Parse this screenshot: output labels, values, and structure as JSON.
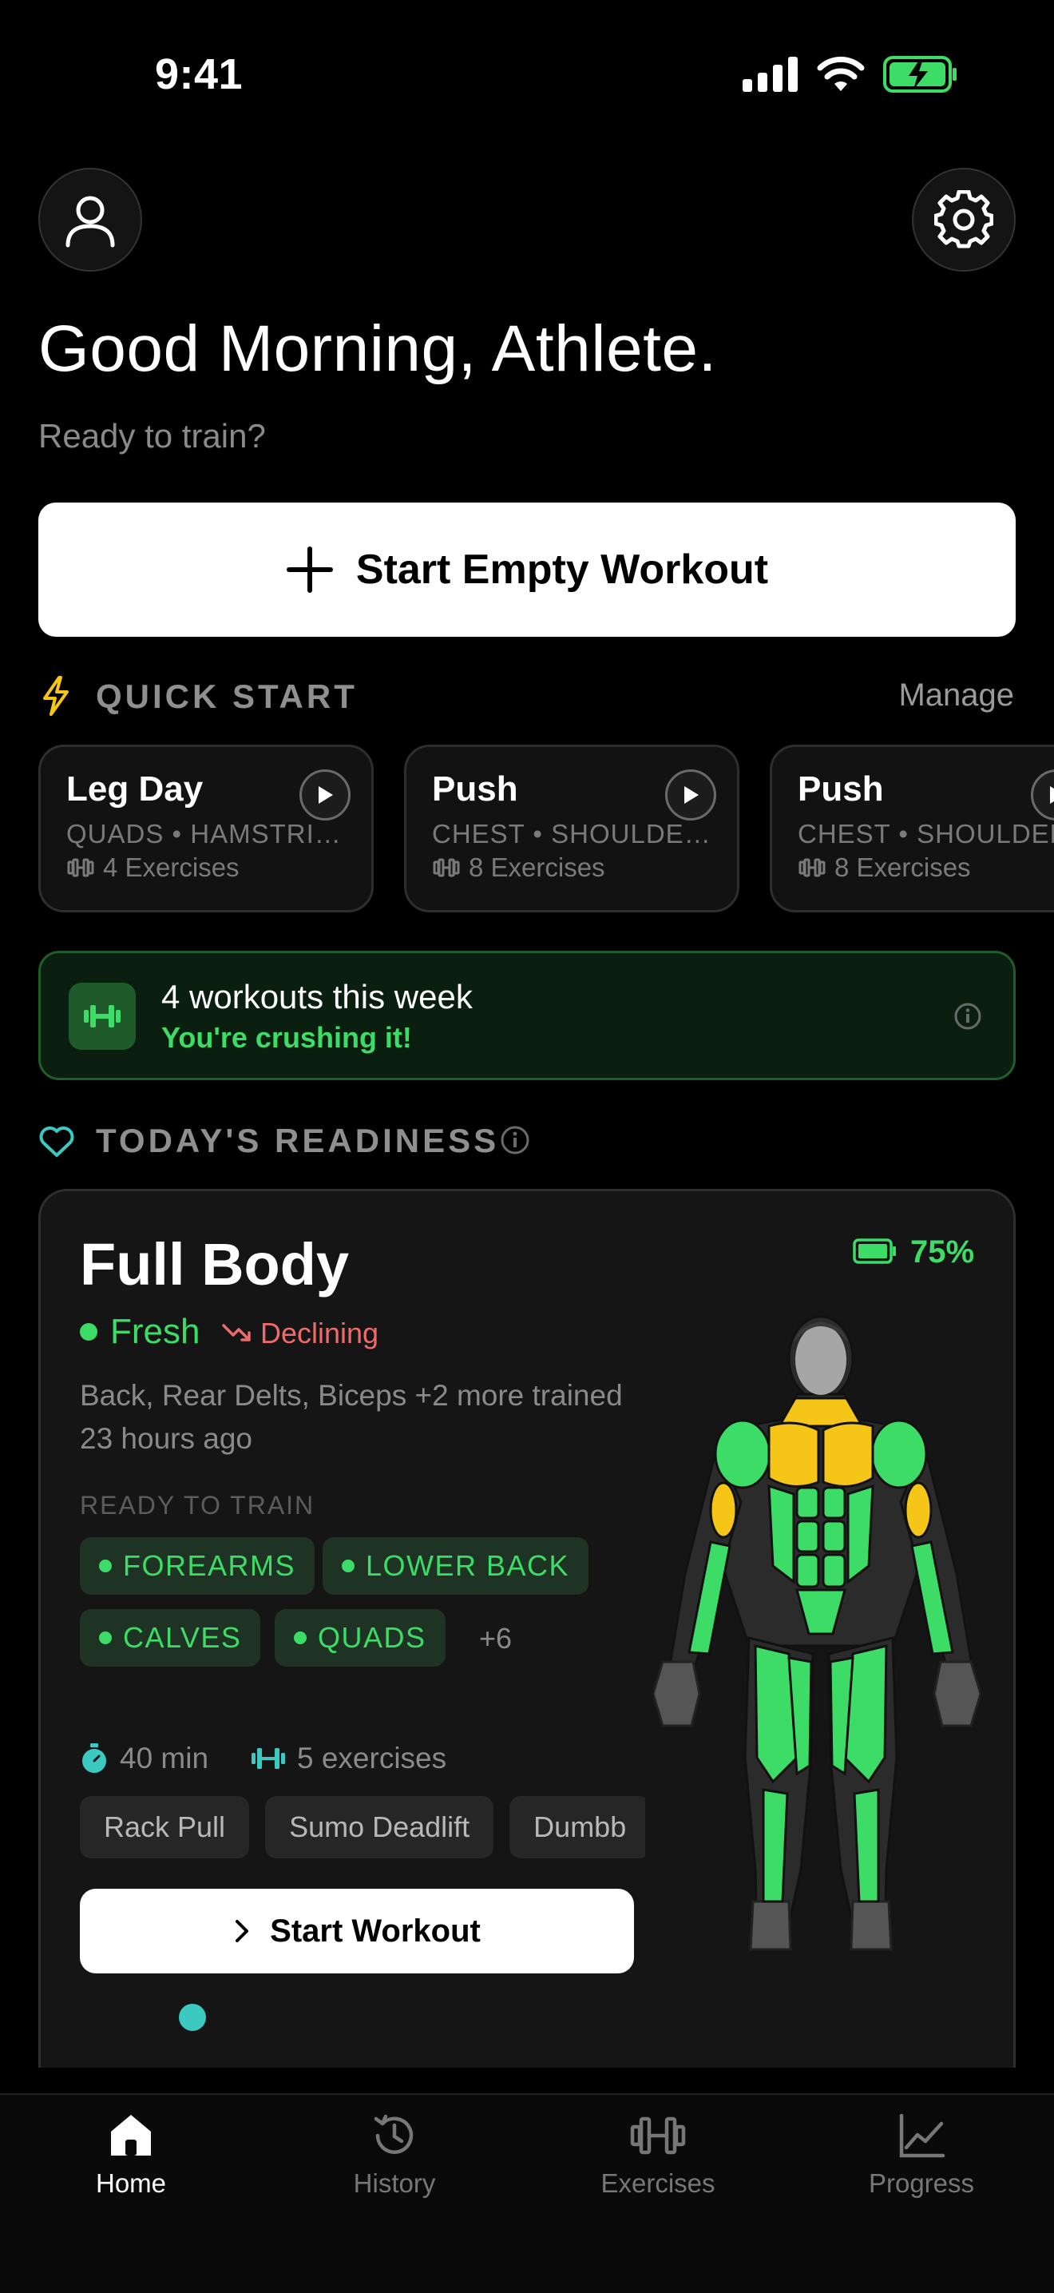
{
  "status_bar": {
    "time": "9:41"
  },
  "header": {
    "greeting": "Good Morning, Athlete.",
    "subtitle": "Ready to train?"
  },
  "start_empty": {
    "label": "Start Empty Workout"
  },
  "quick_start": {
    "title": "QUICK START",
    "manage_label": "Manage",
    "cards": [
      {
        "name": "Leg Day",
        "muscles": "QUADS • HAMSTRIN...",
        "exercises": "4 Exercises"
      },
      {
        "name": "Push",
        "muscles": "CHEST • SHOULDER...",
        "exercises": "8 Exercises"
      },
      {
        "name": "Push",
        "muscles": "CHEST • SHOULDER",
        "exercises": "8 Exercises"
      }
    ]
  },
  "weekly": {
    "title": "4 workouts this week",
    "subtitle": "You're crushing it!"
  },
  "readiness": {
    "section_title": "TODAY'S READINESS",
    "workout_title": "Full Body",
    "battery": "75%",
    "status": "Fresh",
    "trend": "Declining",
    "trained_text": "Back, Rear Delts, Biceps +2 more trained 23 hours ago",
    "ready_label": "READY TO TRAIN",
    "chips": [
      "FOREARMS",
      "LOWER BACK",
      "CALVES",
      "QUADS"
    ],
    "more": "+6",
    "duration": "40 min",
    "exercise_count": "5 exercises",
    "exercises": [
      "Rack Pull",
      "Sumo Deadlift",
      "Dumbb"
    ],
    "start_label": "Start Workout"
  },
  "tabs": [
    {
      "label": "Home",
      "icon": "home-icon",
      "active": true
    },
    {
      "label": "History",
      "icon": "history-icon",
      "active": false
    },
    {
      "label": "Exercises",
      "icon": "dumbbell-icon",
      "active": false
    },
    {
      "label": "Progress",
      "icon": "chart-icon",
      "active": false
    }
  ],
  "colors": {
    "accent_green": "#3ddc67",
    "declining_red": "#ef6b6b",
    "teal": "#3cc9c2",
    "yellow": "#f5c518"
  }
}
